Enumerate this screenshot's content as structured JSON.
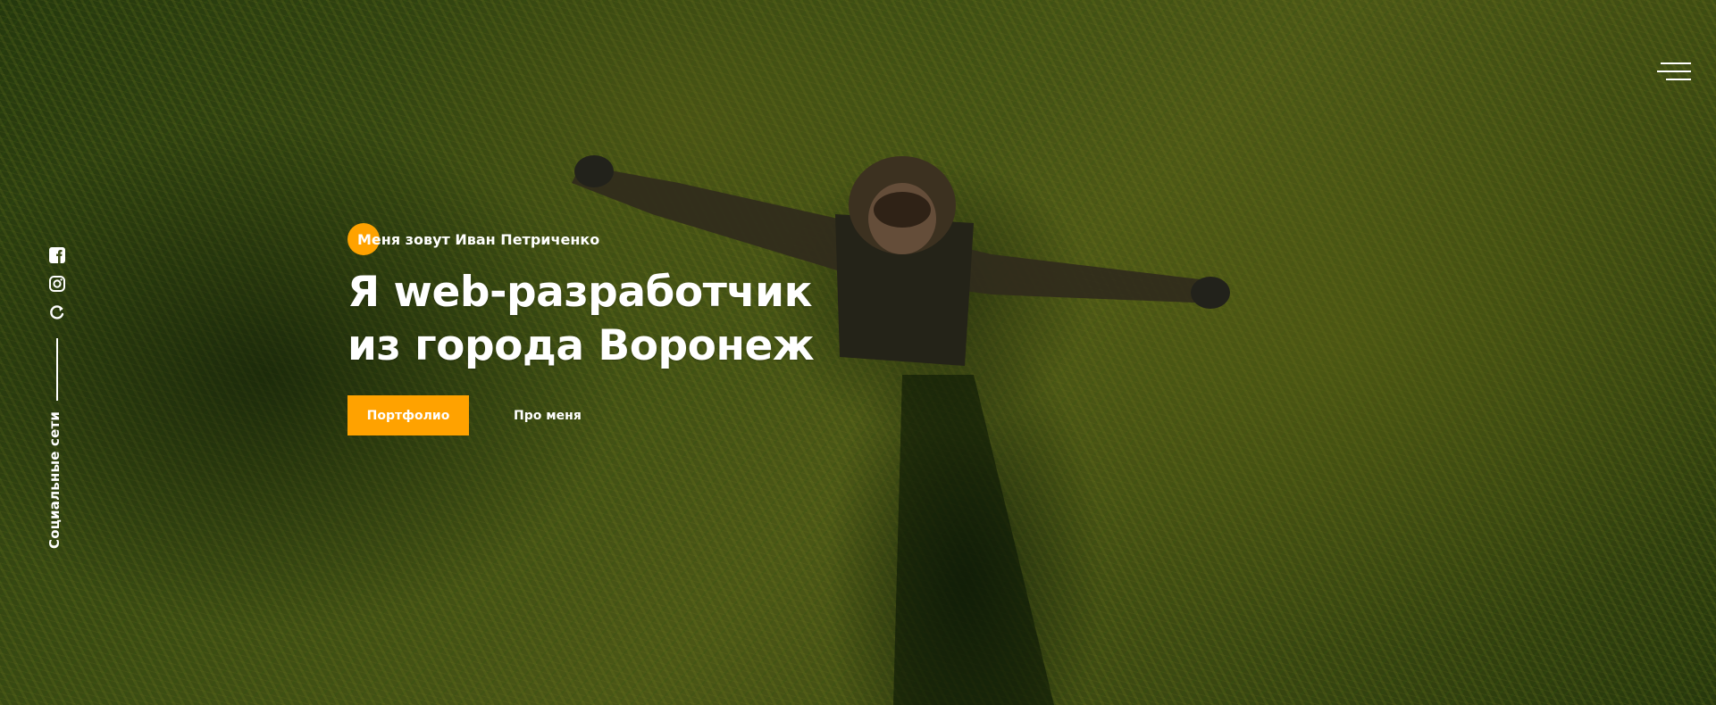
{
  "header": {
    "menu_icon": "hamburger-menu-icon"
  },
  "hero": {
    "intro": "Меня зовут Иван Петриченко",
    "title_line1": "Я web-разработчик",
    "title_line2": "из города Воронеж",
    "primary_button": "Портфолио",
    "secondary_link": "Про меня",
    "accent_color": "#ffa200"
  },
  "social": {
    "label": "Социальные сети",
    "icons": [
      "facebook-icon",
      "instagram-icon",
      "refresh-icon"
    ]
  }
}
